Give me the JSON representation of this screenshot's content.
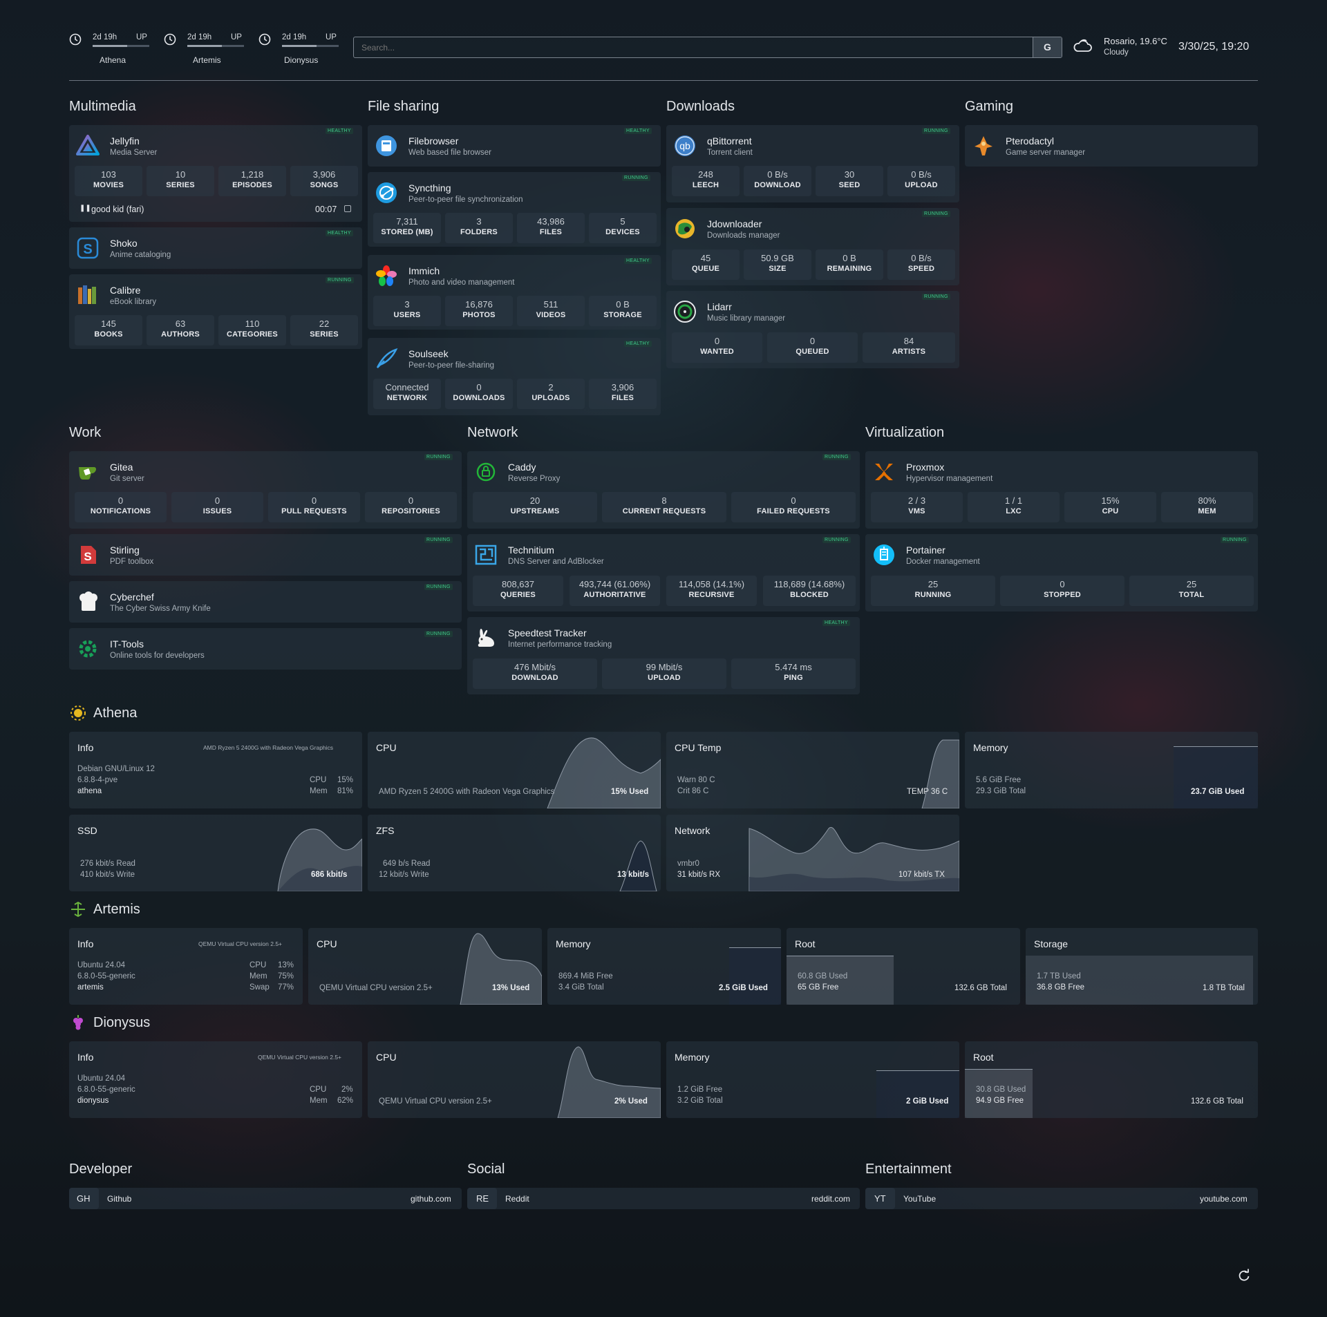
{
  "header": {
    "hosts": [
      {
        "uptime": "2d 19h",
        "state": "UP",
        "name": "Athena"
      },
      {
        "uptime": "2d 19h",
        "state": "UP",
        "name": "Artemis"
      },
      {
        "uptime": "2d 19h",
        "state": "UP",
        "name": "Dionysus"
      }
    ],
    "search": {
      "placeholder": "Search...",
      "engine": "G"
    },
    "weather": {
      "location_temp": "Rosario, 19.6°C",
      "condition": "Cloudy"
    },
    "datetime": "3/30/25, 19:20"
  },
  "sections": {
    "multimedia": "Multimedia",
    "file_sharing": "File sharing",
    "downloads": "Downloads",
    "gaming": "Gaming",
    "work": "Work",
    "network": "Network",
    "virtualization": "Virtualization",
    "developer": "Developer",
    "social": "Social",
    "entertainment": "Entertainment"
  },
  "status": {
    "healthy": "HEALTHY",
    "running": "RUNNING"
  },
  "services": {
    "jellyfin": {
      "name": "Jellyfin",
      "desc": "Media Server",
      "stats": [
        {
          "v": "103",
          "l": "MOVIES"
        },
        {
          "v": "10",
          "l": "SERIES"
        },
        {
          "v": "1,218",
          "l": "EPISODES"
        },
        {
          "v": "3,906",
          "l": "SONGS"
        }
      ],
      "now_playing": "good kid (fari)",
      "time": "00:07"
    },
    "shoko": {
      "name": "Shoko",
      "desc": "Anime cataloging"
    },
    "calibre": {
      "name": "Calibre",
      "desc": "eBook library",
      "stats": [
        {
          "v": "145",
          "l": "BOOKS"
        },
        {
          "v": "63",
          "l": "AUTHORS"
        },
        {
          "v": "110",
          "l": "CATEGORIES"
        },
        {
          "v": "22",
          "l": "SERIES"
        }
      ]
    },
    "filebrowser": {
      "name": "Filebrowser",
      "desc": "Web based file browser"
    },
    "syncthing": {
      "name": "Syncthing",
      "desc": "Peer-to-peer file synchronization",
      "stats": [
        {
          "v": "7,311",
          "l": "STORED (MB)"
        },
        {
          "v": "3",
          "l": "FOLDERS"
        },
        {
          "v": "43,986",
          "l": "FILES"
        },
        {
          "v": "5",
          "l": "DEVICES"
        }
      ]
    },
    "immich": {
      "name": "Immich",
      "desc": "Photo and video management",
      "stats": [
        {
          "v": "3",
          "l": "USERS"
        },
        {
          "v": "16,876",
          "l": "PHOTOS"
        },
        {
          "v": "511",
          "l": "VIDEOS"
        },
        {
          "v": "0 B",
          "l": "STORAGE"
        }
      ]
    },
    "soulseek": {
      "name": "Soulseek",
      "desc": "Peer-to-peer file-sharing",
      "stats": [
        {
          "v": "Connected",
          "l": "NETWORK"
        },
        {
          "v": "0",
          "l": "DOWNLOADS"
        },
        {
          "v": "2",
          "l": "UPLOADS"
        },
        {
          "v": "3,906",
          "l": "FILES"
        }
      ]
    },
    "qbittorrent": {
      "name": "qBittorrent",
      "desc": "Torrent client",
      "stats": [
        {
          "v": "248",
          "l": "LEECH"
        },
        {
          "v": "0 B/s",
          "l": "DOWNLOAD"
        },
        {
          "v": "30",
          "l": "SEED"
        },
        {
          "v": "0 B/s",
          "l": "UPLOAD"
        }
      ]
    },
    "jdownloader": {
      "name": "Jdownloader",
      "desc": "Downloads manager",
      "stats": [
        {
          "v": "45",
          "l": "QUEUE"
        },
        {
          "v": "50.9 GB",
          "l": "SIZE"
        },
        {
          "v": "0 B",
          "l": "REMAINING"
        },
        {
          "v": "0 B/s",
          "l": "SPEED"
        }
      ]
    },
    "lidarr": {
      "name": "Lidarr",
      "desc": "Music library manager",
      "stats": [
        {
          "v": "0",
          "l": "WANTED"
        },
        {
          "v": "0",
          "l": "QUEUED"
        },
        {
          "v": "84",
          "l": "ARTISTS"
        }
      ]
    },
    "pterodactyl": {
      "name": "Pterodactyl",
      "desc": "Game server manager"
    },
    "gitea": {
      "name": "Gitea",
      "desc": "Git server",
      "stats": [
        {
          "v": "0",
          "l": "NOTIFICATIONS"
        },
        {
          "v": "0",
          "l": "ISSUES"
        },
        {
          "v": "0",
          "l": "PULL REQUESTS"
        },
        {
          "v": "0",
          "l": "REPOSITORIES"
        }
      ]
    },
    "stirling": {
      "name": "Stirling",
      "desc": "PDF toolbox"
    },
    "cyberchef": {
      "name": "Cyberchef",
      "desc": "The Cyber Swiss Army Knife"
    },
    "ittools": {
      "name": "IT-Tools",
      "desc": "Online tools for developers"
    },
    "caddy": {
      "name": "Caddy",
      "desc": "Reverse Proxy",
      "stats": [
        {
          "v": "20",
          "l": "UPSTREAMS"
        },
        {
          "v": "8",
          "l": "CURRENT REQUESTS"
        },
        {
          "v": "0",
          "l": "FAILED REQUESTS"
        }
      ]
    },
    "technitium": {
      "name": "Technitium",
      "desc": "DNS Server and AdBlocker",
      "stats": [
        {
          "v": "808,637",
          "l": "QUERIES"
        },
        {
          "v": "493,744 (61.06%)",
          "l": "AUTHORITATIVE"
        },
        {
          "v": "114,058 (14.1%)",
          "l": "RECURSIVE"
        },
        {
          "v": "118,689 (14.68%)",
          "l": "BLOCKED"
        }
      ]
    },
    "speedtest": {
      "name": "Speedtest Tracker",
      "desc": "Internet performance tracking",
      "stats": [
        {
          "v": "476 Mbit/s",
          "l": "DOWNLOAD"
        },
        {
          "v": "99 Mbit/s",
          "l": "UPLOAD"
        },
        {
          "v": "5.474 ms",
          "l": "PING"
        }
      ]
    },
    "proxmox": {
      "name": "Proxmox",
      "desc": "Hypervisor management",
      "stats": [
        {
          "v": "2 / 3",
          "l": "VMS"
        },
        {
          "v": "1 / 1",
          "l": "LXC"
        },
        {
          "v": "15%",
          "l": "CPU"
        },
        {
          "v": "80%",
          "l": "MEM"
        }
      ]
    },
    "portainer": {
      "name": "Portainer",
      "desc": "Docker management",
      "stats": [
        {
          "v": "25",
          "l": "RUNNING"
        },
        {
          "v": "0",
          "l": "STOPPED"
        },
        {
          "v": "25",
          "l": "TOTAL"
        }
      ]
    }
  },
  "hosts": {
    "athena": {
      "title": "Athena",
      "info": {
        "label": "Info",
        "cpu_model": "AMD Ryzen 5 2400G with Radeon Vega Graphics",
        "os": "Debian GNU/Linux 12",
        "kernel": "6.8.8-4-pve",
        "hostname": "athena",
        "k1": "CPU",
        "v1": "15%",
        "k2": "Mem",
        "v2": "81%"
      },
      "cpu": {
        "label": "CPU",
        "model": "AMD Ryzen 5 2400G with Radeon Vega Graphics",
        "used": "15% Used"
      },
      "temp": {
        "label": "CPU Temp",
        "warn": "Warn 80 C",
        "crit": "Crit 86 C",
        "value": "TEMP 36 C"
      },
      "memory": {
        "label": "Memory",
        "free": "5.6 GiB Free",
        "total": "29.3 GiB Total",
        "used": "23.7 GiB Used",
        "fraction": 0.81
      },
      "ssd": {
        "label": "SSD",
        "read": "276 kbit/s Read",
        "write": "410 kbit/s Write",
        "value": "686 kbit/s"
      },
      "zfs": {
        "label": "ZFS",
        "read": "649 b/s Read",
        "write": "12 kbit/s Write",
        "value": "13 kbit/s"
      },
      "network": {
        "label": "Network",
        "iface": "vmbr0",
        "rx": "31 kbit/s RX",
        "tx": "107 kbit/s TX"
      }
    },
    "artemis": {
      "title": "Artemis",
      "info": {
        "label": "Info",
        "cpu_model": "QEMU Virtual CPU version 2.5+",
        "os": "Ubuntu 24.04",
        "kernel": "6.8.0-55-generic",
        "hostname": "artemis",
        "k1": "CPU",
        "v1": "13%",
        "k2": "Mem",
        "v2": "75%",
        "k3": "Swap",
        "v3": "77%"
      },
      "cpu": {
        "label": "CPU",
        "model": "QEMU Virtual CPU version 2.5+",
        "used": "13% Used"
      },
      "memory": {
        "label": "Memory",
        "free": "869.4 MiB Free",
        "total": "3.4 GiB Total",
        "used": "2.5 GiB Used",
        "fraction": 0.75
      },
      "root": {
        "label": "Root",
        "used": "60.8 GB Used",
        "free": "65 GB Free",
        "total": "132.6 GB Total",
        "fraction": 0.46
      },
      "storage": {
        "label": "Storage",
        "used": "1.7 TB Used",
        "free": "36.8 GB Free",
        "total": "1.8 TB Total",
        "fraction": 0.98
      }
    },
    "dionysus": {
      "title": "Dionysus",
      "info": {
        "label": "Info",
        "cpu_model": "QEMU Virtual CPU version 2.5+",
        "os": "Ubuntu 24.04",
        "kernel": "6.8.0-55-generic",
        "hostname": "dionysus",
        "k1": "CPU",
        "v1": "2%",
        "k2": "Mem",
        "v2": "62%"
      },
      "cpu": {
        "label": "CPU",
        "model": "QEMU Virtual CPU version 2.5+",
        "used": "2% Used"
      },
      "memory": {
        "label": "Memory",
        "free": "1.2 GiB Free",
        "total": "3.2 GiB Total",
        "used": "2 GiB Used",
        "fraction": 0.62
      },
      "root": {
        "label": "Root",
        "used": "30.8 GB Used",
        "free": "94.9 GB Free",
        "total": "132.6 GB Total",
        "fraction": 0.23
      }
    }
  },
  "bookmarks": {
    "developer": {
      "abbr": "GH",
      "name": "Github",
      "url": "github.com"
    },
    "social": {
      "abbr": "RE",
      "name": "Reddit",
      "url": "reddit.com"
    },
    "entertainment": {
      "abbr": "YT",
      "name": "YouTube",
      "url": "youtube.com"
    }
  },
  "icons": {
    "clock": "clock-icon",
    "weather": "cloud-icon",
    "refresh": "refresh-icon"
  }
}
